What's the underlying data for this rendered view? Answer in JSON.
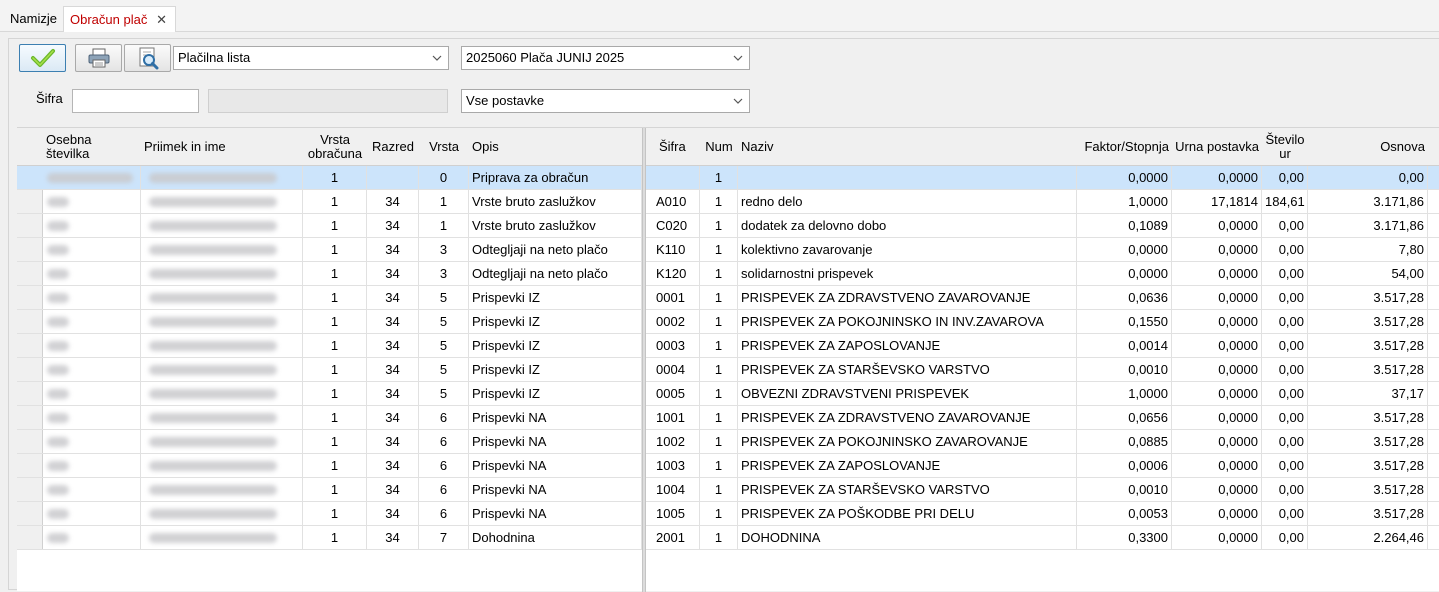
{
  "tabs": [
    {
      "label": "Namizje"
    },
    {
      "label": "Obračun plač"
    }
  ],
  "toolbar": {
    "report_type": "Plačilna lista",
    "period": "2025060 Plača JUNIJ 2025",
    "filter_label": "Šifra",
    "sifra_value": "",
    "postavke": "Vse postavke"
  },
  "columns": {
    "osebna": "Osebna številka",
    "priimek": "Priimek in ime",
    "vrsta_obr": "Vrsta obračuna",
    "razred": "Razred",
    "vrsta": "Vrsta",
    "opis": "Opis",
    "sifra": "Šifra",
    "num": "Num",
    "naziv": "Naziv",
    "faktor": "Faktor/Stopnja",
    "urna": "Urna postavka",
    "stevilo": "Število ur",
    "osnova": "Osnova"
  },
  "rows": [
    {
      "vrsta_obr": "1",
      "razred": "",
      "vrsta": "0",
      "opis": "Priprava za obračun",
      "sifra": "",
      "num": "1",
      "naziv": "",
      "faktor": "0,0000",
      "urna": "0,0000",
      "stevilo": "0,00",
      "osnova": "0,00"
    },
    {
      "vrsta_obr": "1",
      "razred": "34",
      "vrsta": "1",
      "opis": "Vrste bruto zaslužkov",
      "sifra": "A010",
      "num": "1",
      "naziv": "redno delo",
      "faktor": "1,0000",
      "urna": "17,1814",
      "stevilo": "184,61",
      "osnova": "3.171,86"
    },
    {
      "vrsta_obr": "1",
      "razred": "34",
      "vrsta": "1",
      "opis": "Vrste bruto zaslužkov",
      "sifra": "C020",
      "num": "1",
      "naziv": "dodatek za delovno dobo",
      "faktor": "0,1089",
      "urna": "0,0000",
      "stevilo": "0,00",
      "osnova": "3.171,86"
    },
    {
      "vrsta_obr": "1",
      "razred": "34",
      "vrsta": "3",
      "opis": "Odtegljaji na neto plačo",
      "sifra": "K110",
      "num": "1",
      "naziv": "kolektivno zavarovanje",
      "faktor": "0,0000",
      "urna": "0,0000",
      "stevilo": "0,00",
      "osnova": "7,80"
    },
    {
      "vrsta_obr": "1",
      "razred": "34",
      "vrsta": "3",
      "opis": "Odtegljaji na neto plačo",
      "sifra": "K120",
      "num": "1",
      "naziv": "solidarnostni prispevek",
      "faktor": "0,0000",
      "urna": "0,0000",
      "stevilo": "0,00",
      "osnova": "54,00"
    },
    {
      "vrsta_obr": "1",
      "razred": "34",
      "vrsta": "5",
      "opis": "Prispevki IZ",
      "sifra": "0001",
      "num": "1",
      "naziv": "PRISPEVEK ZA ZDRAVSTVENO ZAVAROVANJE",
      "faktor": "0,0636",
      "urna": "0,0000",
      "stevilo": "0,00",
      "osnova": "3.517,28"
    },
    {
      "vrsta_obr": "1",
      "razred": "34",
      "vrsta": "5",
      "opis": "Prispevki IZ",
      "sifra": "0002",
      "num": "1",
      "naziv": "PRISPEVEK ZA POKOJNINSKO IN INV.ZAVAROVA",
      "faktor": "0,1550",
      "urna": "0,0000",
      "stevilo": "0,00",
      "osnova": "3.517,28"
    },
    {
      "vrsta_obr": "1",
      "razred": "34",
      "vrsta": "5",
      "opis": "Prispevki IZ",
      "sifra": "0003",
      "num": "1",
      "naziv": "PRISPEVEK ZA ZAPOSLOVANJE",
      "faktor": "0,0014",
      "urna": "0,0000",
      "stevilo": "0,00",
      "osnova": "3.517,28"
    },
    {
      "vrsta_obr": "1",
      "razred": "34",
      "vrsta": "5",
      "opis": "Prispevki IZ",
      "sifra": "0004",
      "num": "1",
      "naziv": "PRISPEVEK ZA STARŠEVSKO VARSTVO",
      "faktor": "0,0010",
      "urna": "0,0000",
      "stevilo": "0,00",
      "osnova": "3.517,28"
    },
    {
      "vrsta_obr": "1",
      "razred": "34",
      "vrsta": "5",
      "opis": "Prispevki IZ",
      "sifra": "0005",
      "num": "1",
      "naziv": "OBVEZNI ZDRAVSTVENI PRISPEVEK",
      "faktor": "1,0000",
      "urna": "0,0000",
      "stevilo": "0,00",
      "osnova": "37,17"
    },
    {
      "vrsta_obr": "1",
      "razred": "34",
      "vrsta": "6",
      "opis": "Prispevki NA",
      "sifra": "1001",
      "num": "1",
      "naziv": "PRISPEVEK ZA ZDRAVSTVENO ZAVAROVANJE",
      "faktor": "0,0656",
      "urna": "0,0000",
      "stevilo": "0,00",
      "osnova": "3.517,28"
    },
    {
      "vrsta_obr": "1",
      "razred": "34",
      "vrsta": "6",
      "opis": "Prispevki NA",
      "sifra": "1002",
      "num": "1",
      "naziv": "PRISPEVEK ZA POKOJNINSKO ZAVAROVANJE",
      "faktor": "0,0885",
      "urna": "0,0000",
      "stevilo": "0,00",
      "osnova": "3.517,28"
    },
    {
      "vrsta_obr": "1",
      "razred": "34",
      "vrsta": "6",
      "opis": "Prispevki NA",
      "sifra": "1003",
      "num": "1",
      "naziv": "PRISPEVEK ZA ZAPOSLOVANJE",
      "faktor": "0,0006",
      "urna": "0,0000",
      "stevilo": "0,00",
      "osnova": "3.517,28"
    },
    {
      "vrsta_obr": "1",
      "razred": "34",
      "vrsta": "6",
      "opis": "Prispevki NA",
      "sifra": "1004",
      "num": "1",
      "naziv": "PRISPEVEK ZA STARŠEVSKO VARSTVO",
      "faktor": "0,0010",
      "urna": "0,0000",
      "stevilo": "0,00",
      "osnova": "3.517,28"
    },
    {
      "vrsta_obr": "1",
      "razred": "34",
      "vrsta": "6",
      "opis": "Prispevki NA",
      "sifra": "1005",
      "num": "1",
      "naziv": "PRISPEVEK ZA POŠKODBE PRI DELU",
      "faktor": "0,0053",
      "urna": "0,0000",
      "stevilo": "0,00",
      "osnova": "3.517,28"
    },
    {
      "vrsta_obr": "1",
      "razred": "34",
      "vrsta": "7",
      "opis": "Dohodnina",
      "sifra": "2001",
      "num": "1",
      "naziv": "DOHODNINA",
      "faktor": "0,3300",
      "urna": "0,0000",
      "stevilo": "0,00",
      "osnova": "2.264,46"
    }
  ]
}
